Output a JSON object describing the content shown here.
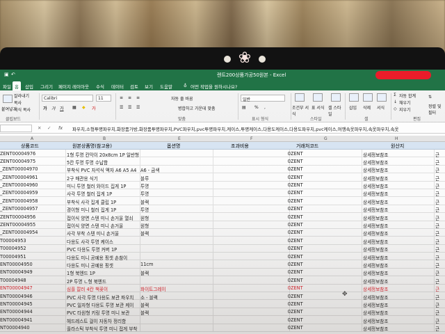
{
  "window": {
    "title": "렌트200상품가공50원본 -  Excel",
    "tell_me": "어떤 작업을 원하시나요?"
  },
  "menu_tabs": [
    {
      "label": "파일"
    },
    {
      "label": "홈"
    },
    {
      "label": "삽입"
    },
    {
      "label": "그리기"
    },
    {
      "label": "페이지 레이아웃"
    },
    {
      "label": "수식"
    },
    {
      "label": "데이터"
    },
    {
      "label": "검토"
    },
    {
      "label": "보기"
    },
    {
      "label": "도움말"
    }
  ],
  "ribbon": {
    "clipboard": {
      "cut": "잘라내기",
      "copy": "복사",
      "format_painter": "서식 복사",
      "paste": "붙여넣기",
      "group": "클립보드"
    },
    "font": {
      "name": "Calibri",
      "size": "11"
    },
    "align": {
      "wrap": "자동 줄 바꿈",
      "merge": "병합하고 가운데 맞춤",
      "group": "맞춤"
    },
    "number": {
      "format": "일반",
      "group": "표시 형식"
    },
    "styles": {
      "conditional": "조건부 서식",
      "table": "표 서식",
      "cell": "셀 스타일",
      "group": "스타일"
    },
    "cells": {
      "insert": "삽입",
      "delete": "삭제",
      "format": "서식",
      "group": "셀"
    },
    "editing": {
      "autosum": "자동 합계",
      "fill": "채우기",
      "clear": "지우기",
      "sort": "정렬 및 필터",
      "group": "편집"
    }
  },
  "formula_bar": {
    "fx": "fx",
    "value": "파우치,소형투명파우치,화장품가방,화장품투명파우치,PVC파우치,pvc투명파우치,케이스,투명케이스,다용도케이스,다용도파우치,pvc케이스,여행속옷파우치,속옷파우치,속옷"
  },
  "columns": [
    "A",
    "B",
    "E",
    "F",
    "G",
    "H"
  ],
  "headers": {
    "a": "상품코드",
    "b": "원본상품명(참고용)",
    "c": "옵션명",
    "f": "조과비용",
    "g": "거래처코드",
    "i": "원산지"
  },
  "rows": [
    {
      "code": "ZENT00004976",
      "name": "1형 투명 칸막이 20x8cm 1P 일반형",
      "opt": "",
      "cost": "0",
      "vendor": "ZENT",
      "origin": "상세정보참조",
      "k": "근"
    },
    {
      "code": "ZENT00004975",
      "name": "5칸 투명 투명 수납함",
      "opt": "",
      "cost": "0",
      "vendor": "ZENT",
      "origin": "상세정보참조",
      "k": "근"
    },
    {
      "code": "_ZENT00004970",
      "name": "부착식 PVC 자석식 액자 A6 A5 A4",
      "opt": "A6 - 금색",
      "cost": "0",
      "vendor": "ZENT",
      "origin": "상세정보참조",
      "k": "근"
    },
    {
      "code": "_ZENT00004961",
      "name": "2구 매관용 식기",
      "opt": "블루",
      "cost": "0",
      "vendor": "ZENT",
      "origin": "상세정보참조",
      "k": "근"
    },
    {
      "code": "_ZENT00004960",
      "name": "미니 투명 철러 와이드 집게 1P",
      "opt": "투명",
      "cost": "0",
      "vendor": "ZENT",
      "origin": "상세정보참조",
      "k": "근"
    },
    {
      "code": "_ZENT00004959",
      "name": "사각 투명 철러 집게 1P",
      "opt": "투명",
      "cost": "0",
      "vendor": "ZENT",
      "origin": "상세정보참조",
      "k": "근"
    },
    {
      "code": "_ZENT00004958",
      "name": "부착식 사각 집게 클립 1P",
      "opt": "블랙",
      "cost": "0",
      "vendor": "ZENT",
      "origin": "상세정보참조",
      "k": "근"
    },
    {
      "code": "_ZENT00004957",
      "name": "경이형 미니 철러 집게 1P",
      "opt": "투명",
      "cost": "0",
      "vendor": "ZENT",
      "origin": "상세정보참조",
      "k": "근"
    },
    {
      "code": "ZENT00004956",
      "name": "접이식 양면 스텐 미니 손거울 열쇠",
      "opt": "원형",
      "cost": "0",
      "vendor": "ZENT",
      "origin": "상세정보참조",
      "k": "근"
    },
    {
      "code": "ZENT00004955",
      "name": "접이식 양면 스텐 미니 손거울",
      "opt": "원형",
      "cost": "0",
      "vendor": "ZENT",
      "origin": "상세정보참조",
      "k": "근"
    },
    {
      "code": "_ZENT00004954",
      "name": "사각 부착 스텐 미니 손거울",
      "opt": "블랙",
      "cost": "0",
      "vendor": "ZENT",
      "origin": "상세정보참조",
      "k": "근"
    },
    {
      "code": "T00004953",
      "name": "다용도 사각 투명 케이스",
      "opt": "",
      "cost": "0",
      "vendor": "ZENT",
      "origin": "상세정보참조",
      "k": "근"
    },
    {
      "code": "T00004952",
      "name": "PVC 다용도 투명 커버 1P",
      "opt": "",
      "cost": "0",
      "vendor": "ZENT",
      "origin": "상세정보참조",
      "k": "근"
    },
    {
      "code": "T00004951",
      "name": "다용도 미니 공예용 핑셋 손참이",
      "opt": "",
      "cost": "0",
      "vendor": "ZENT",
      "origin": "상세정보참조",
      "k": "근"
    },
    {
      "code": "ENT00004950",
      "name": "다용도 미니 공예용 핑셋",
      "opt": "11cm",
      "cost": "0",
      "vendor": "ZENT",
      "origin": "상세정보참조",
      "k": "근"
    },
    {
      "code": "ENT00004949",
      "name": "1형 북엔드 1P",
      "opt": "블랙",
      "cost": "0",
      "vendor": "ZENT",
      "origin": "상세정보참조",
      "k": "근"
    },
    {
      "code": "T00004948",
      "name": "2P 투명 ㄴ형 북엔드",
      "opt": "",
      "cost": "0",
      "vendor": "ZENT",
      "origin": "상세정보참조",
      "k": "근"
    },
    {
      "code": "ENT00004947",
      "name": "심플 칼러 4칸 책꽂이",
      "opt": "화이트그레이",
      "cost": "0",
      "vendor": "ZENT",
      "origin": "상세정보참조",
      "k": "근",
      "red": true
    },
    {
      "code": "ENT00004946",
      "name": "PVC 사각 투명 다용도 보관 파우치",
      "opt": "소 - 블랙",
      "cost": "0",
      "vendor": "ZENT",
      "origin": "상세정보참조",
      "k": "근"
    },
    {
      "code": "ENT00004945",
      "name": "PVC 일자형 다용도 투명 보관 케이",
      "opt": "블랙",
      "cost": "0",
      "vendor": "ZENT",
      "origin": "상세정보참조",
      "k": "근"
    },
    {
      "code": "ENT00004944",
      "name": "PVC 타원형 키링 투명 미니 보관",
      "opt": "블랙",
      "cost": "0",
      "vendor": "ZENT",
      "origin": "상세정보참조",
      "k": "근"
    },
    {
      "code": "ENT00004941",
      "name": "헤드레스트 걸이 자동차 정리함",
      "opt": "",
      "cost": "0",
      "vendor": "ZENT",
      "origin": "상세정보참조",
      "k": "근"
    },
    {
      "code": "NT00004940",
      "name": "플라스틱 부착식 투명 미니 접게 부착",
      "opt": "",
      "cost": "0",
      "vendor": "ZENT",
      "origin": "상세정보참조",
      "k": "근"
    }
  ]
}
